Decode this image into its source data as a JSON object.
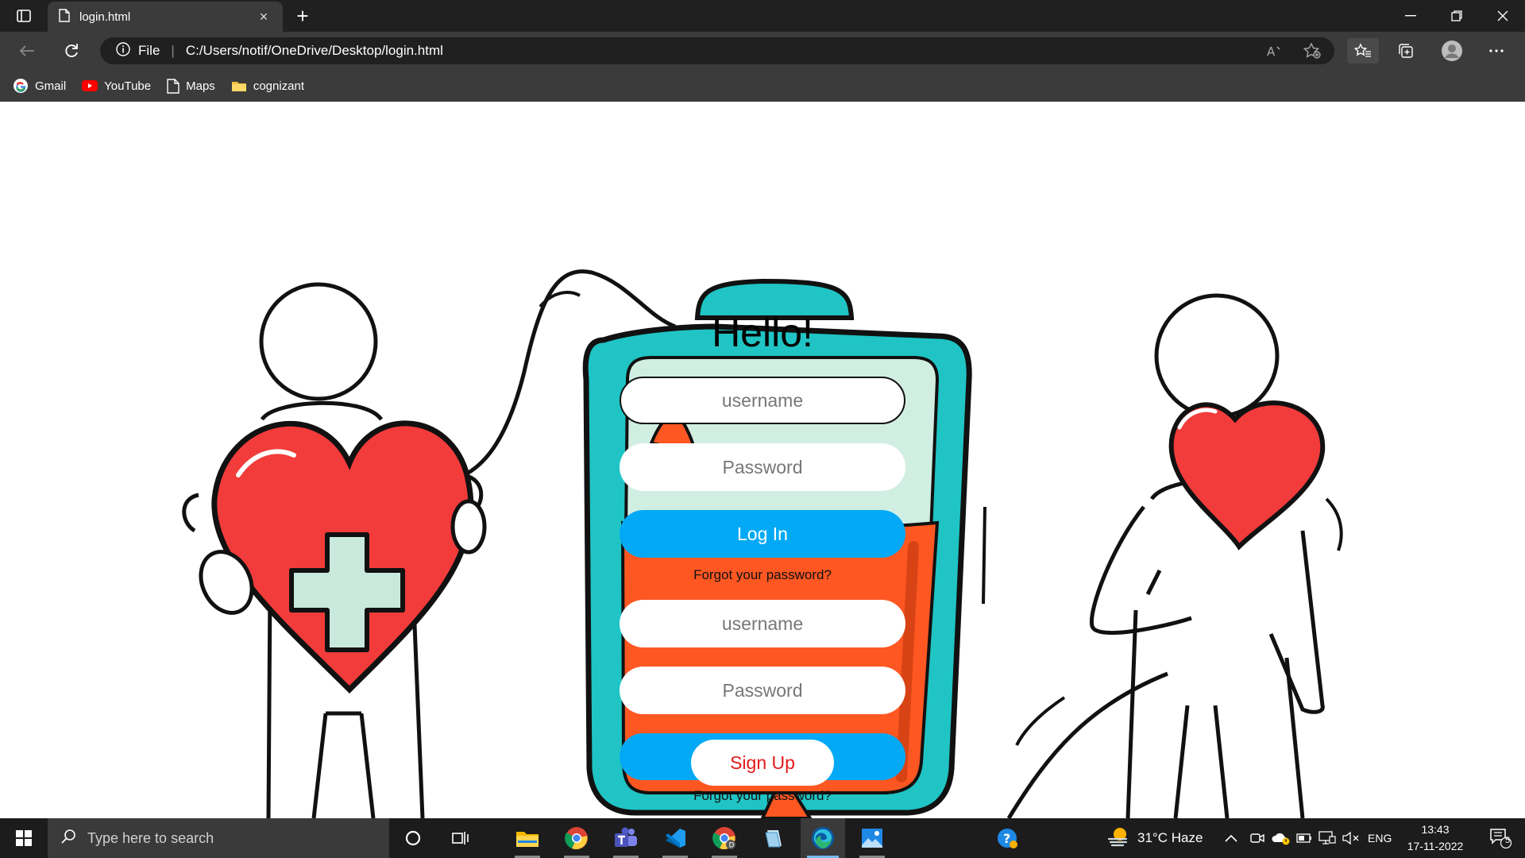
{
  "browser": {
    "tab_title": "login.html",
    "tab_close": "×",
    "new_tab": "+",
    "address_scheme": "File",
    "address_url": "C:/Users/notif/OneDrive/Desktop/login.html",
    "bookmarks": [
      {
        "label": "Gmail",
        "icon": "google-icon"
      },
      {
        "label": "YouTube",
        "icon": "youtube-icon"
      },
      {
        "label": "Maps",
        "icon": "page-icon"
      },
      {
        "label": "cognizant",
        "icon": "folder-icon"
      }
    ]
  },
  "page": {
    "heading": "Hello!",
    "login": {
      "username_placeholder": "username",
      "password_placeholder": "Password",
      "button": "Log In",
      "forgot": "Forgot your password?"
    },
    "signup": {
      "username_placeholder": "username",
      "password_placeholder": "Password",
      "button": "Sign Up",
      "forgot": "Forgot your password?"
    }
  },
  "taskbar": {
    "search_placeholder": "Type here to search",
    "weather": "31°C  Haze",
    "language": "ENG",
    "time": "13:43",
    "date": "17-11-2022",
    "notification_count": "5"
  },
  "colors": {
    "accent_blue": "#03a9f4",
    "signup_text": "#e01a1a",
    "bag_teal": "#20c4c4",
    "blood_orange": "#ff5722",
    "heart_red": "#f23b3b"
  }
}
